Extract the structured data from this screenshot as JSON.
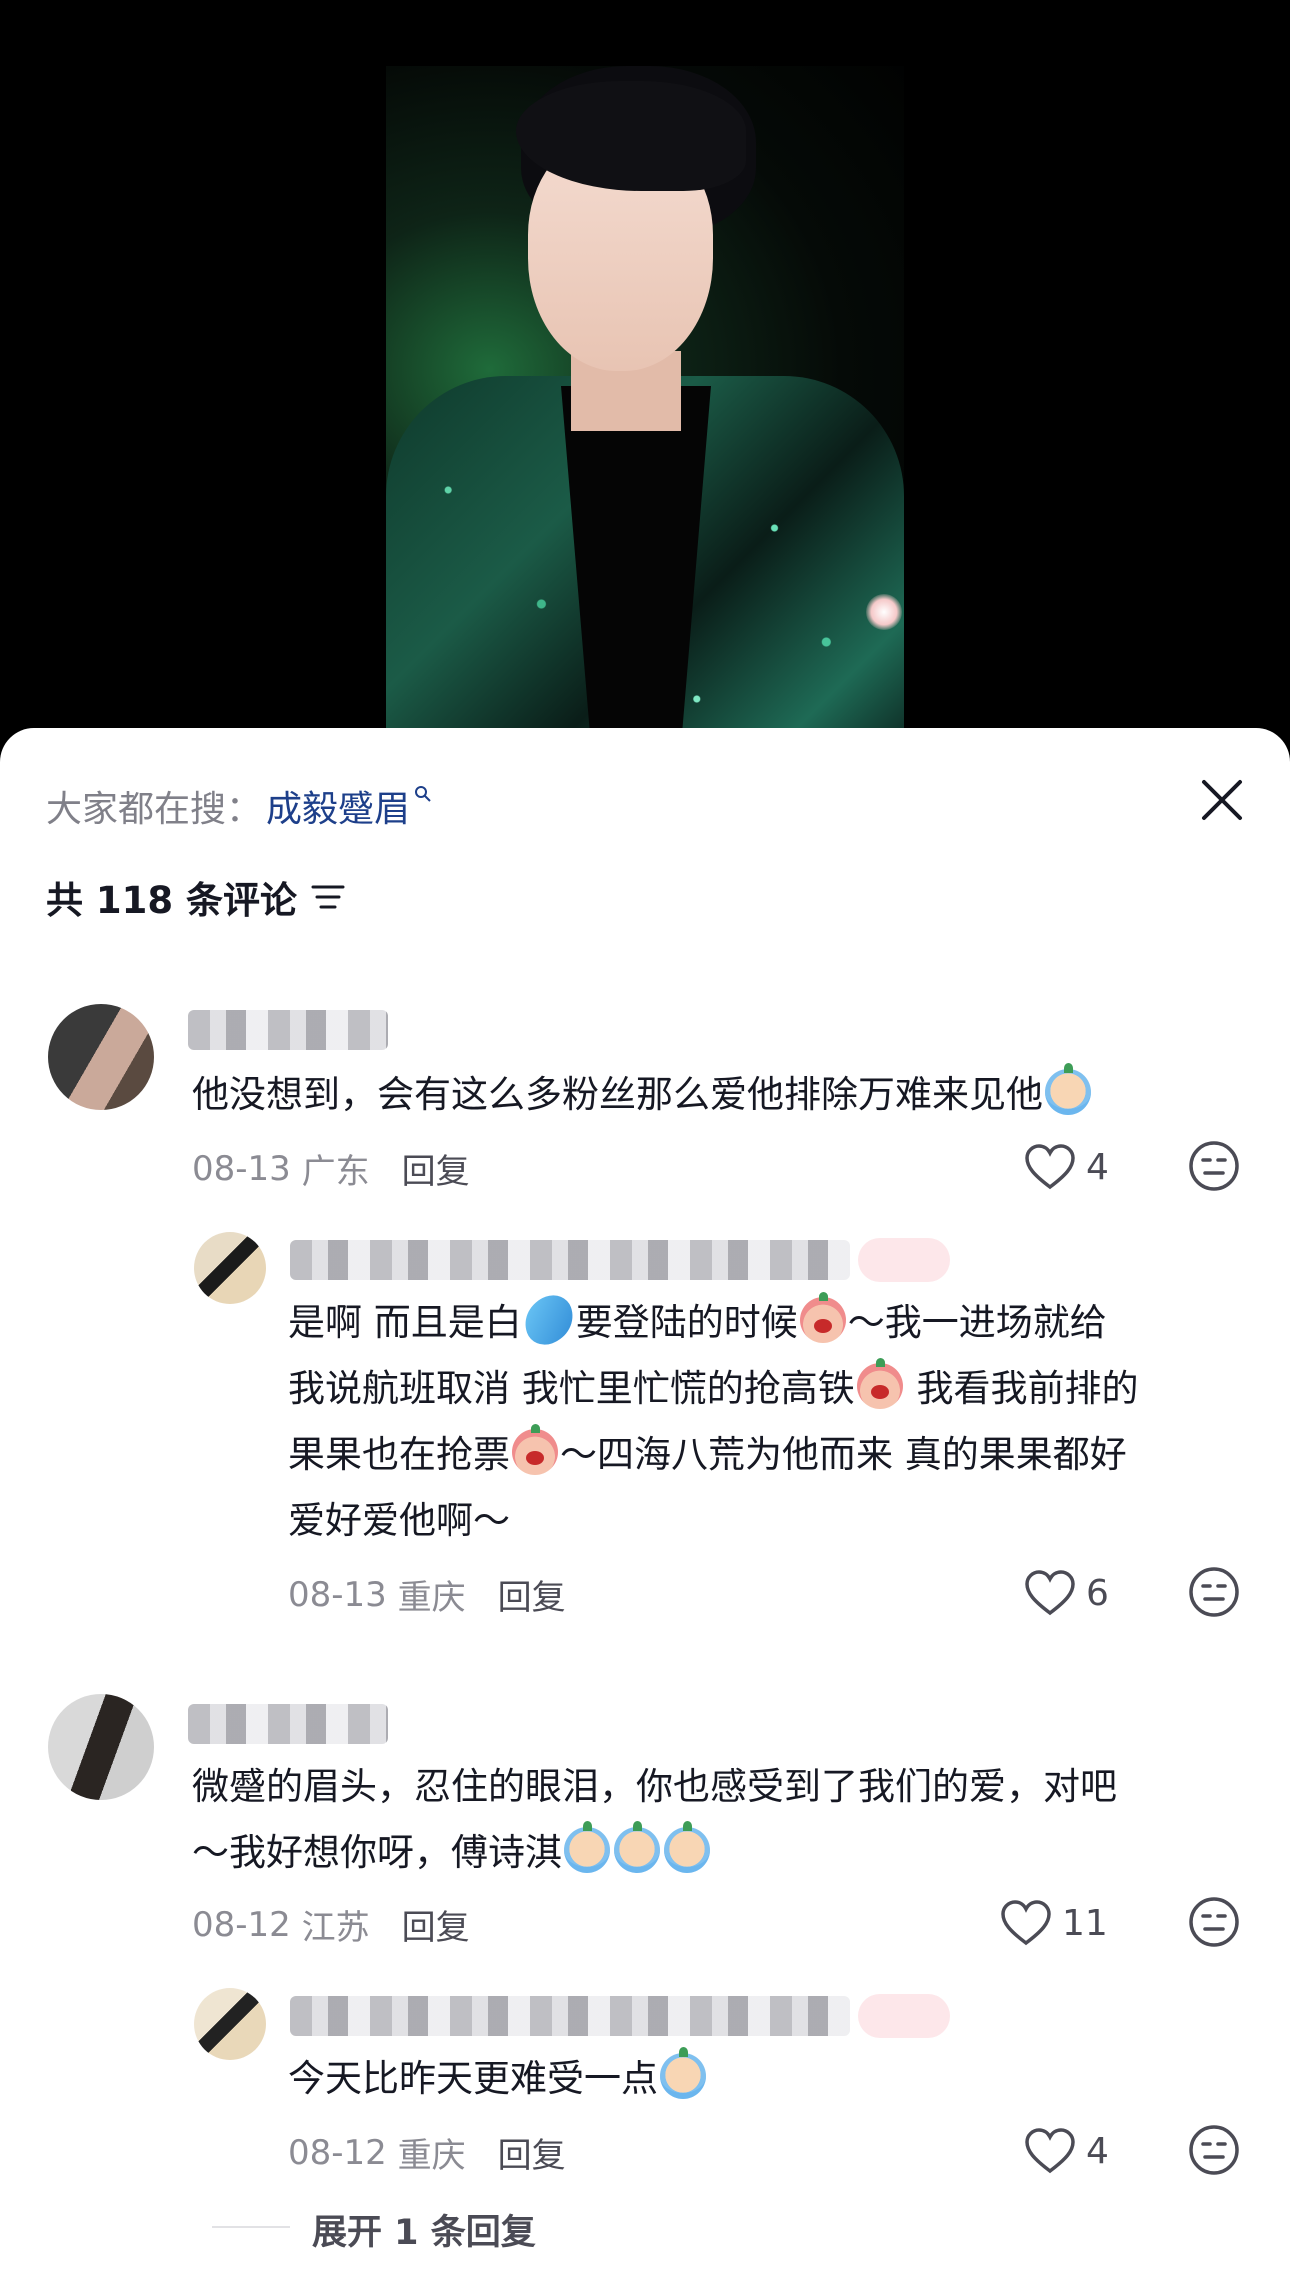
{
  "search": {
    "prefix": "大家都在搜：",
    "term": "成毅蹙眉",
    "term_icon": "search-icon",
    "close_icon": "close-icon"
  },
  "comments_header": {
    "count_label": "共 118 条评论",
    "sort_icon": "sort-icon"
  },
  "comments": [
    {
      "text": "他没想到，会有这么多粉丝那么爱他排除万难来见他",
      "emoji_end": "cry-emoji",
      "date": "08-13",
      "location": "广东",
      "reply_label": "回复",
      "likes": "4"
    },
    {
      "text_lines": [
        "是啊 而且是白",
        "要登陆的时候",
        "～我一进场就给",
        "我说航班取消 我忙里忙慌的抢高铁",
        " 我看我前排的",
        "果果也在抢票",
        "～四海八荒为他而来 真的果果都好",
        "爱好爱他啊～"
      ],
      "date": "08-13",
      "location": "重庆",
      "reply_label": "回复",
      "likes": "6"
    },
    {
      "text_lines": [
        "微蹙的眉头，忍住的眼泪，你也感受到了我们的爱，对吧",
        "～我好想你呀，傅诗淇"
      ],
      "date": "08-12",
      "location": "江苏",
      "reply_label": "回复",
      "likes": "11"
    },
    {
      "text": "今天比昨天更难受一点",
      "date": "08-12",
      "location": "重庆",
      "reply_label": "回复",
      "likes": "4"
    }
  ],
  "expand": {
    "label": "展开 1 条回复"
  },
  "colors": {
    "search_term": "#1d3f8a",
    "secondary_text": "#8b8b93",
    "primary_text": "#161823"
  }
}
